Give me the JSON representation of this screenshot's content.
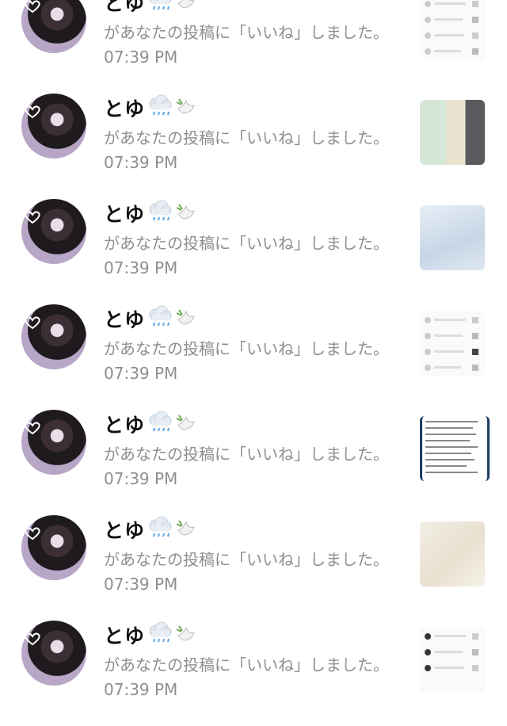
{
  "notifications": [
    {
      "name": "とゆ",
      "icons": [
        "rain-cloud-icon",
        "dove-icon"
      ],
      "message": "があなたの投稿に「いいね」しました。",
      "time": "07:39 PM",
      "thumbnail": "screenshot-list-thumbnail"
    },
    {
      "name": "とゆ",
      "icons": [
        "rain-cloud-icon",
        "dove-icon"
      ],
      "message": "があなたの投稿に「いいね」しました。",
      "time": "07:39 PM",
      "thumbnail": "photo-thumbnail"
    },
    {
      "name": "とゆ",
      "icons": [
        "rain-cloud-icon",
        "dove-icon"
      ],
      "message": "があなたの投稿に「いいね」しました。",
      "time": "07:39 PM",
      "thumbnail": "photo-thumbnail"
    },
    {
      "name": "とゆ",
      "icons": [
        "rain-cloud-icon",
        "dove-icon"
      ],
      "message": "があなたの投稿に「いいね」しました。",
      "time": "07:39 PM",
      "thumbnail": "screenshot-list-thumbnail"
    },
    {
      "name": "とゆ",
      "icons": [
        "rain-cloud-icon",
        "dove-icon"
      ],
      "message": "があなたの投稿に「いいね」しました。",
      "time": "07:39 PM",
      "thumbnail": "text-document-thumbnail"
    },
    {
      "name": "とゆ",
      "icons": [
        "rain-cloud-icon",
        "dove-icon"
      ],
      "message": "があなたの投稿に「いいね」しました。",
      "time": "07:39 PM",
      "thumbnail": "photo-thumbnail"
    },
    {
      "name": "とゆ",
      "icons": [
        "rain-cloud-icon",
        "dove-icon"
      ],
      "message": "があなたの投稿に「いいね」しました。",
      "time": "07:39 PM",
      "thumbnail": "screenshot-list-thumbnail"
    }
  ],
  "colors": {
    "secondary_text": "#8e8e93",
    "primary_text": "#111111"
  }
}
